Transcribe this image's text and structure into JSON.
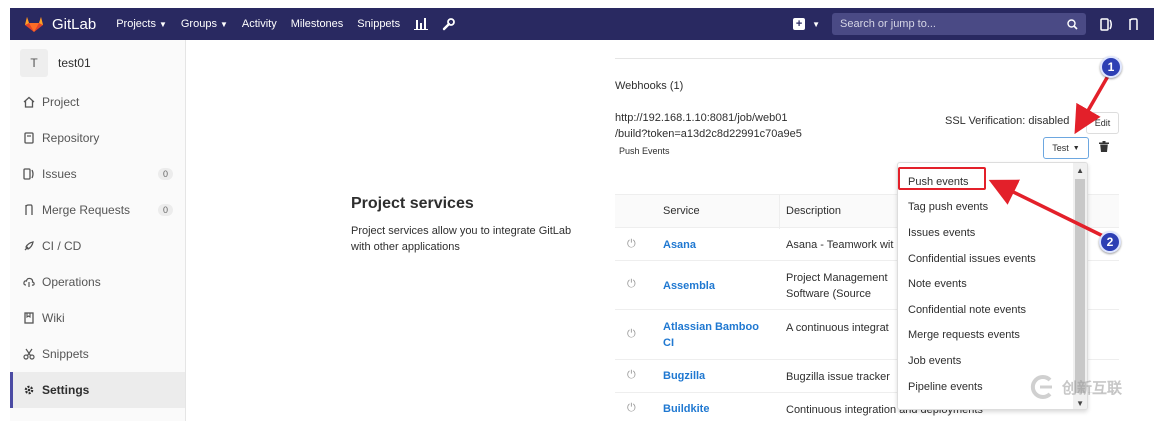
{
  "topbar": {
    "brand": "GitLab",
    "nav": [
      {
        "label": "Projects",
        "dropdown": true
      },
      {
        "label": "Groups",
        "dropdown": true
      },
      {
        "label": "Activity",
        "dropdown": false
      },
      {
        "label": "Milestones",
        "dropdown": false
      },
      {
        "label": "Snippets",
        "dropdown": false
      }
    ],
    "nav_icons": [
      "chart-bar-icon",
      "wrench-icon"
    ],
    "search_placeholder": "Search or jump to...",
    "right_icons": [
      "plus-square-icon",
      "issues-icon",
      "merge-request-icon"
    ],
    "colors": {
      "bar": "#292961",
      "search": "#4a4a85"
    }
  },
  "sidebar": {
    "project_initial": "T",
    "project_name": "test01",
    "items": [
      {
        "label": "Project",
        "icon": "home-icon",
        "badge": null,
        "active": false
      },
      {
        "label": "Repository",
        "icon": "book-icon",
        "badge": null,
        "active": false
      },
      {
        "label": "Issues",
        "icon": "issues-icon",
        "badge": "0",
        "active": false
      },
      {
        "label": "Merge Requests",
        "icon": "merge-request-icon",
        "badge": "0",
        "active": false
      },
      {
        "label": "CI / CD",
        "icon": "rocket-icon",
        "badge": null,
        "active": false
      },
      {
        "label": "Operations",
        "icon": "cloud-icon",
        "badge": null,
        "active": false
      },
      {
        "label": "Wiki",
        "icon": "wiki-icon",
        "badge": null,
        "active": false
      },
      {
        "label": "Snippets",
        "icon": "scissors-icon",
        "badge": null,
        "active": false
      },
      {
        "label": "Settings",
        "icon": "gear-icon",
        "badge": null,
        "active": true
      }
    ]
  },
  "services": {
    "title": "Project services",
    "description": "Project services allow you to integrate GitLab with other applications"
  },
  "webhooks": {
    "title": "Webhooks (1)",
    "url_line1": "http://192.168.1.10:8081/job/web01",
    "url_line2": "/build?token=a13d2c8d22991c70a9e5",
    "tag": "Push Events",
    "ssl": "SSL Verification: disabled",
    "edit_label": "Edit",
    "test_label": "Test"
  },
  "table": {
    "headers": {
      "service": "Service",
      "description": "Description"
    },
    "rows": [
      {
        "service": "Asana",
        "description": "Asana - Teamwork wit"
      },
      {
        "service": "Assembla",
        "description": "Project Management Software (Source Commits Endpoint)"
      },
      {
        "service": "Atlassian Bamboo CI",
        "description": "A continuous integrat"
      },
      {
        "service": "Bugzilla",
        "description": "Bugzilla issue tracker"
      },
      {
        "service": "Buildkite",
        "description": "Continuous integration and deployments"
      }
    ]
  },
  "dropdown": {
    "items": [
      "Push events",
      "Tag push events",
      "Issues events",
      "Confidential issues events",
      "Note events",
      "Confidential note events",
      "Merge requests events",
      "Job events",
      "Pipeline events"
    ]
  },
  "annotations": {
    "marker1": "1",
    "marker2": "2",
    "color": "#e3202a"
  },
  "watermark": "创新互联"
}
